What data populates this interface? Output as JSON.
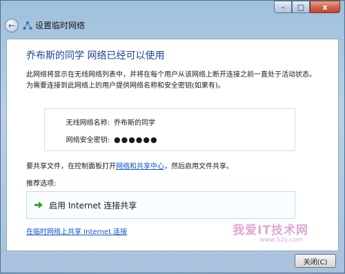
{
  "window": {
    "title": "设置临时网络",
    "controls": {
      "minimize": "–",
      "maximize": "□",
      "close": "x"
    }
  },
  "content": {
    "heading": "乔布斯的同学 网络已经可以使用",
    "description": "此网络将显示在无线网络列表中，并将在每个用户从该网络上断开连接之前一直处于活动状态。为需要连接到此网络上的用户提供网络名称和安全密钥(如果有)。",
    "network_name_label": "无线网络名称:",
    "network_name_value": "乔布斯的同学",
    "security_key_label": "网络安全密钥:",
    "security_key_value": "●●●●●●",
    "share_text_before": "要共享文件，在控制面板打开",
    "share_link": "网络和共享中心",
    "share_text_after": "，然后启用文件共享。",
    "recommended_label": "推荐选项:",
    "option_label": "启用 Internet 连接共享",
    "bottom_link": "在临时网络上共享 Internet 连接"
  },
  "footer": {
    "close_button": "关闭(C)"
  },
  "watermark": {
    "text": "我爱IT技术网",
    "url": "www.52ij.com"
  },
  "colors": {
    "heading": "#1e3f9b",
    "link": "#0b55c7",
    "option_arrow": "#2e9e2e"
  }
}
